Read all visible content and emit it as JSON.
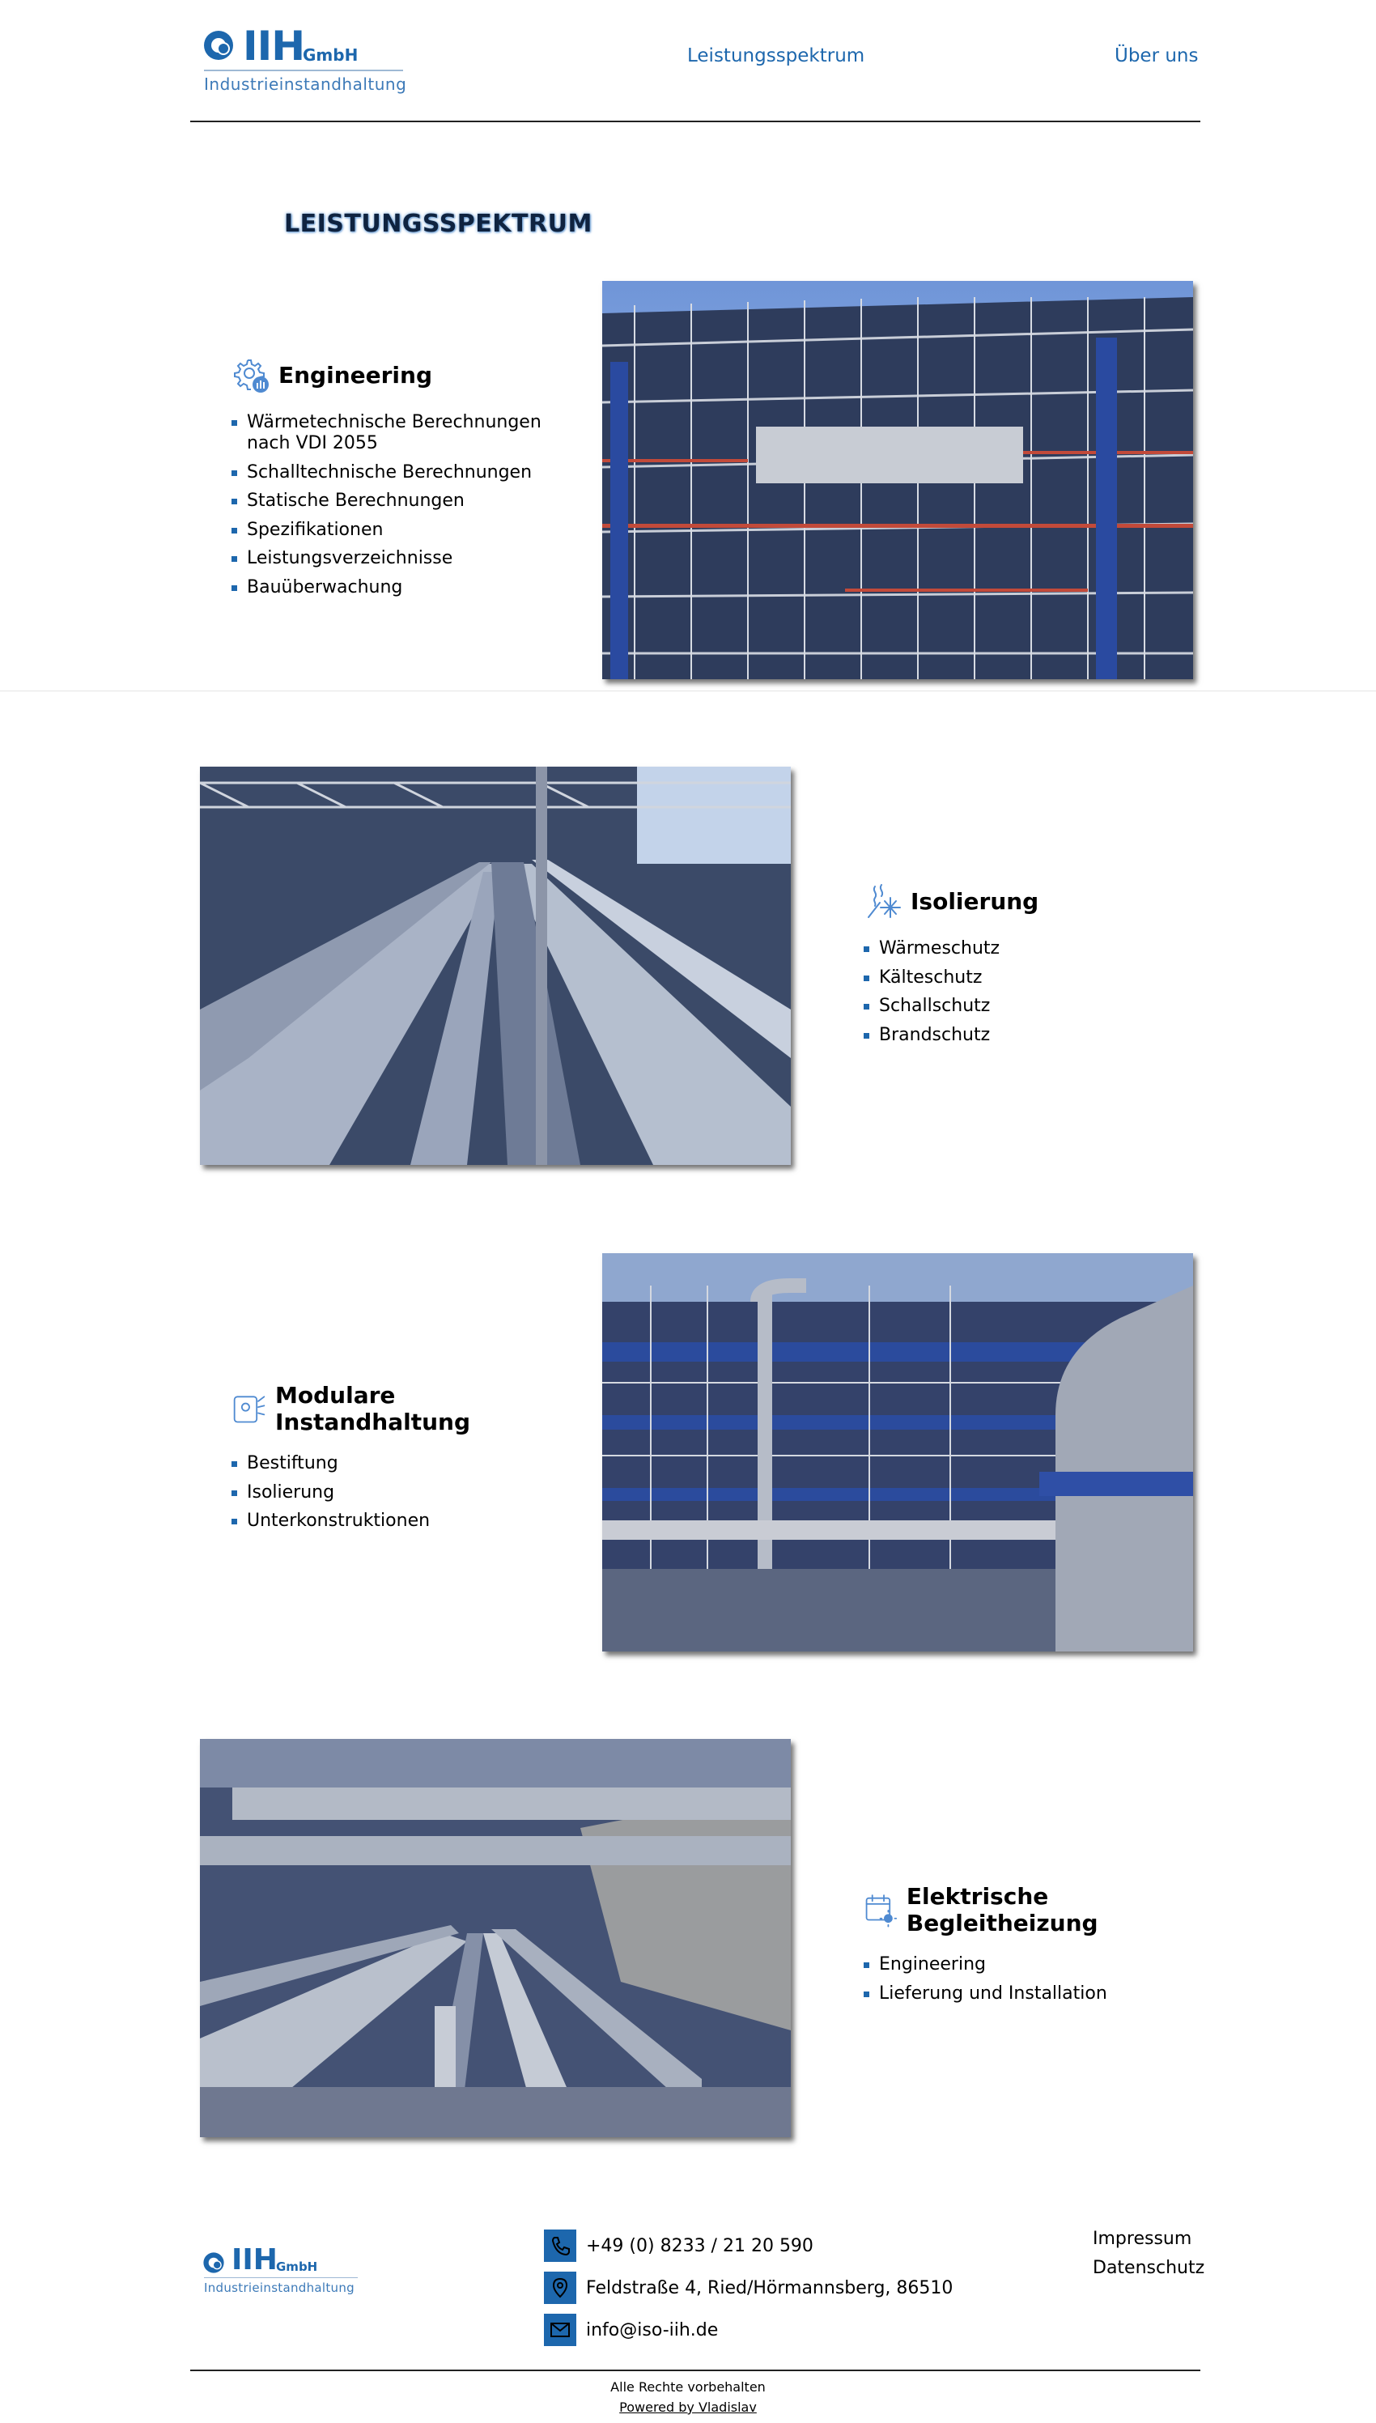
{
  "header": {
    "logo": {
      "brand": "IIH",
      "suffix": "GmbH",
      "tagline": "Industrieinstandhaltung"
    },
    "nav": [
      {
        "label": "Leistungsspektrum"
      },
      {
        "label": "Über uns"
      }
    ]
  },
  "page_title": "LEISTUNGSSPEKTRUM",
  "services": [
    {
      "title": "Engineering",
      "icon": "gear-chart-icon",
      "items": [
        "Wärmetechnische Berechnungen nach VDI 2055",
        "Schalltechnische Berechnungen",
        "Statische Berechnungen",
        "Spezifikationen",
        "Leistungsverzeichnisse",
        "Bauüberwachung"
      ]
    },
    {
      "title": "Isolierung",
      "icon": "heat-cold-icon",
      "items": [
        "Wärmeschutz",
        "Kälteschutz",
        "Schallschutz",
        "Brandschutz"
      ]
    },
    {
      "title": "Modulare Instandhaltung",
      "icon": "maintenance-icon",
      "items": [
        "Bestiftung",
        "Isolierung",
        "Unterkonstruktionen"
      ]
    },
    {
      "title": "Elektrische Begleitheizung",
      "icon": "calendar-heat-icon",
      "items": [
        "Engineering",
        "Lieferung und Installation"
      ]
    }
  ],
  "footer": {
    "logo": {
      "brand": "IIH",
      "suffix": "GmbH",
      "tagline": "Industrieinstandhaltung"
    },
    "phone": "+49 (0) 8233 / 21 20 590",
    "address": "Feldstraße 4, Ried/Hörmannsberg, 86510",
    "email": "info@iso-iih.de",
    "links": [
      "Impressum",
      "Datenschutz"
    ],
    "rights": "Alle Rechte vorbehalten",
    "powered": "Powered by Vladislav"
  },
  "colors": {
    "brand": "#1d67ad",
    "text": "#000000",
    "rule": "#222222"
  }
}
